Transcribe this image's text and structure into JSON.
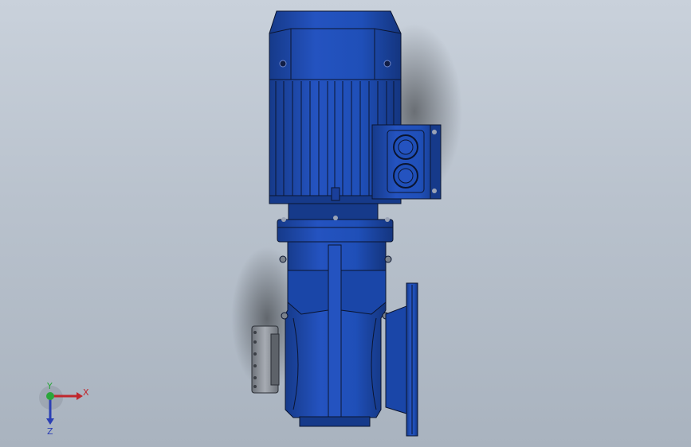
{
  "scene": {
    "background_top": "#c9d1db",
    "background_bottom": "#a9b3bf",
    "part_color": "#1f4fb8",
    "part_shadow": "#163a8a",
    "part_highlight": "#3b6ad6",
    "metal_color": "#8f949c",
    "outline_color": "#0b1530"
  },
  "triad": {
    "x_label": "X",
    "y_label": "Y",
    "z_label": "Z",
    "x_color": "#c0272d",
    "y_color": "#2aa63a",
    "z_color": "#2b3fb4"
  }
}
